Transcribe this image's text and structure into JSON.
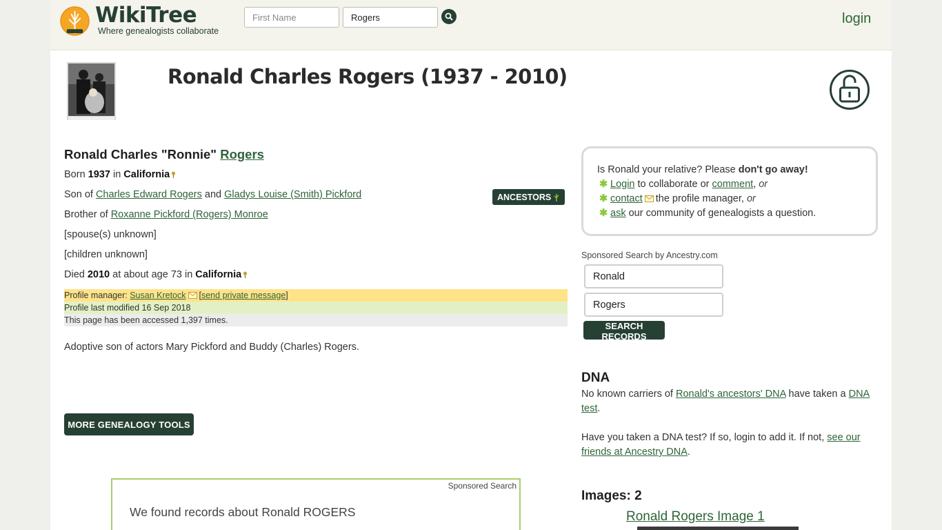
{
  "header": {
    "logo_name": "WikiTree",
    "logo_tagline": "Where genealogists collaborate",
    "first_name_placeholder": "First Name",
    "last_name_value": "Rogers",
    "login_label": "login"
  },
  "profile": {
    "title": "Ronald Charles Rogers (1937 - 2010)",
    "full_name_prefix": "Ronald Charles \"Ronnie\"",
    "surname": "Rogers",
    "born": {
      "label": "Born",
      "year": "1937",
      "in": "in",
      "place": "California"
    },
    "parents": {
      "prefix": "Son of",
      "father": "Charles Edward Rogers",
      "and": "and",
      "mother": "Gladys Louise (Smith) Pickford"
    },
    "sibling": {
      "prefix": "Brother of",
      "name": "Roxanne Pickford (Rogers) Monroe"
    },
    "spouse_text": "[spouse(s) unknown]",
    "children_text": "[children unknown]",
    "died": {
      "label": "Died",
      "year": "2010",
      "age_text": "at about age 73 in",
      "place": "California"
    },
    "ancestors_button": "ANCESTORS",
    "manager": {
      "label": "Profile manager:",
      "name": "Susan Kretock",
      "private_message": "send private message",
      "bracket_open": "[",
      "bracket_close": "]"
    },
    "modified_text": "Profile last modified 16 Sep 2018",
    "accessed_text": "This page has been accessed 1,397 times.",
    "biography": "Adoptive son of actors Mary Pickford and Buddy (Charles) Rogers.",
    "more_tools_button": "MORE GENEALOGY TOOLS"
  },
  "sponsored": {
    "label": "Sponsored Search",
    "records_text": "We found records about Ronald ROGERS"
  },
  "relative_box": {
    "line1_prefix": "Is Ronald your relative? Please",
    "line1_bold": "don't go away!",
    "login_link": "Login",
    "login_rest": "to collaborate or",
    "comment_link": "comment",
    "or": "or",
    "contact_link": "contact",
    "contact_rest": "the profile manager,",
    "ask_link": "ask",
    "ask_rest": "our community of genealogists a question.",
    "comma": ","
  },
  "ancestry_search": {
    "label": "Sponsored Search by Ancestry.com",
    "first_value": "Ronald",
    "last_value": "Rogers",
    "button": "SEARCH RECORDS"
  },
  "dna": {
    "heading": "DNA",
    "p1_prefix": "No known carriers of",
    "p1_link": "Ronald's ancestors' DNA",
    "p1_mid": "have taken a",
    "p1_link2": "DNA test",
    "p1_end": ".",
    "p2_prefix": "Have you taken a DNA test? If so, login to add it. If not,",
    "p2_link": "see our friends at Ancestry DNA",
    "p2_end": "."
  },
  "images": {
    "heading": "Images: 2",
    "image1_link": "Ronald Rogers Image 1"
  },
  "colors": {
    "brand_dark": "#264034",
    "link_green": "#2e6438",
    "star_green": "#8cc63f",
    "manager_bg": "#ffe389",
    "modified_bg": "#e3f0c6"
  }
}
